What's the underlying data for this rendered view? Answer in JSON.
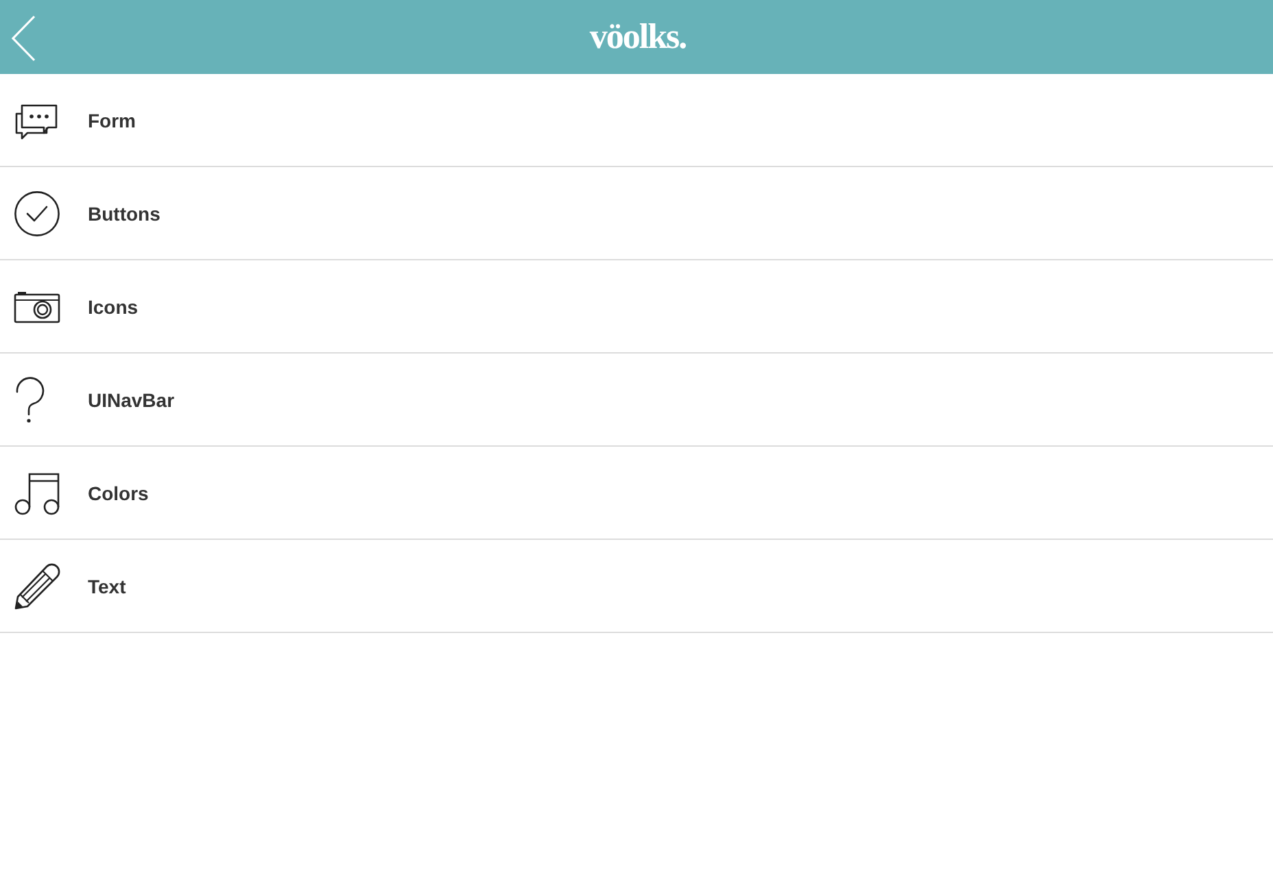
{
  "header": {
    "logo": "vöolks."
  },
  "menu": [
    {
      "label": "Form"
    },
    {
      "label": "Buttons"
    },
    {
      "label": "Icons"
    },
    {
      "label": "UINavBar"
    },
    {
      "label": "Colors"
    },
    {
      "label": "Text"
    }
  ]
}
